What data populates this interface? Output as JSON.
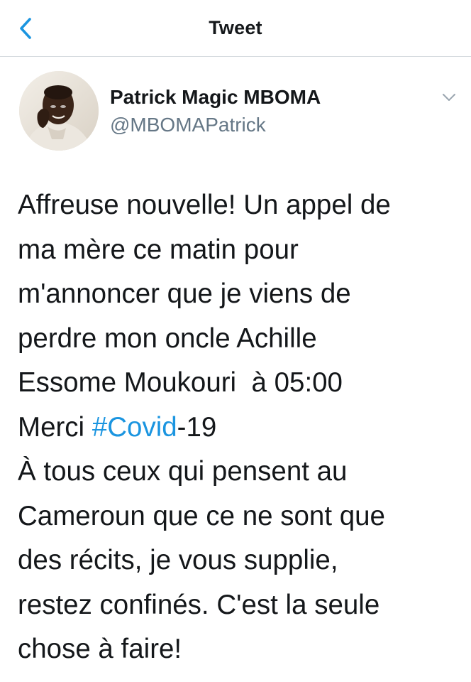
{
  "header": {
    "title": "Tweet",
    "back_icon": "chevron-left-icon"
  },
  "colors": {
    "accent": "#1b95e0",
    "text": "#14171a",
    "secondary": "#657786",
    "divider": "#d6dbdf"
  },
  "tweet": {
    "author_name": "Patrick Magic MBOMA",
    "author_handle": "@MBOMAPatrick",
    "menu_icon": "chevron-down-icon",
    "lines": {
      "l1": "Affreuse nouvelle! Un appel de",
      "l2": "ma mère ce matin pour",
      "l3": "m'annoncer que je viens de",
      "l4": "perdre mon oncle Achille",
      "l5": "Essome Moukouri  à 05:00",
      "l6_prefix": "Merci ",
      "l6_hashtag": "#Covid",
      "l6_suffix": "-19",
      "l7": "À tous ceux qui pensent au",
      "l8": "Cameroun que ce ne sont que",
      "l9": "des récits, je vous supplie,",
      "l10": "restez confinés. C'est la seule",
      "l11": "chose à faire!"
    }
  }
}
